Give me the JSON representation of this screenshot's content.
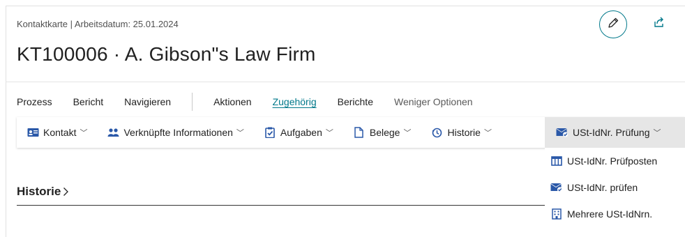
{
  "header": {
    "breadcrumb": "Kontaktkarte | Arbeitsdatum: 25.01.2024",
    "title": "KT100006 · A. Gibson\"s Law Firm"
  },
  "action_tabs": {
    "prozess": "Prozess",
    "bericht": "Bericht",
    "navigieren": "Navigieren",
    "aktionen": "Aktionen",
    "zugehoerig": "Zugehörig",
    "berichte": "Berichte",
    "weniger_optionen": "Weniger Optionen"
  },
  "subbar": {
    "kontakt": "Kontakt",
    "verknuepfte": "Verknüpfte Informationen",
    "aufgaben": "Aufgaben",
    "belege": "Belege",
    "historie": "Historie",
    "ust_pruefung": "USt-IdNr. Prüfung"
  },
  "dropdown": {
    "item1": "USt-IdNr. Prüfposten",
    "item2": "USt-IdNr. prüfen",
    "item3": "Mehrere USt-IdNrn."
  },
  "section": {
    "title": "Historie"
  },
  "colors": {
    "accent": "#00788a",
    "icon_blue": "#2a58a8"
  }
}
